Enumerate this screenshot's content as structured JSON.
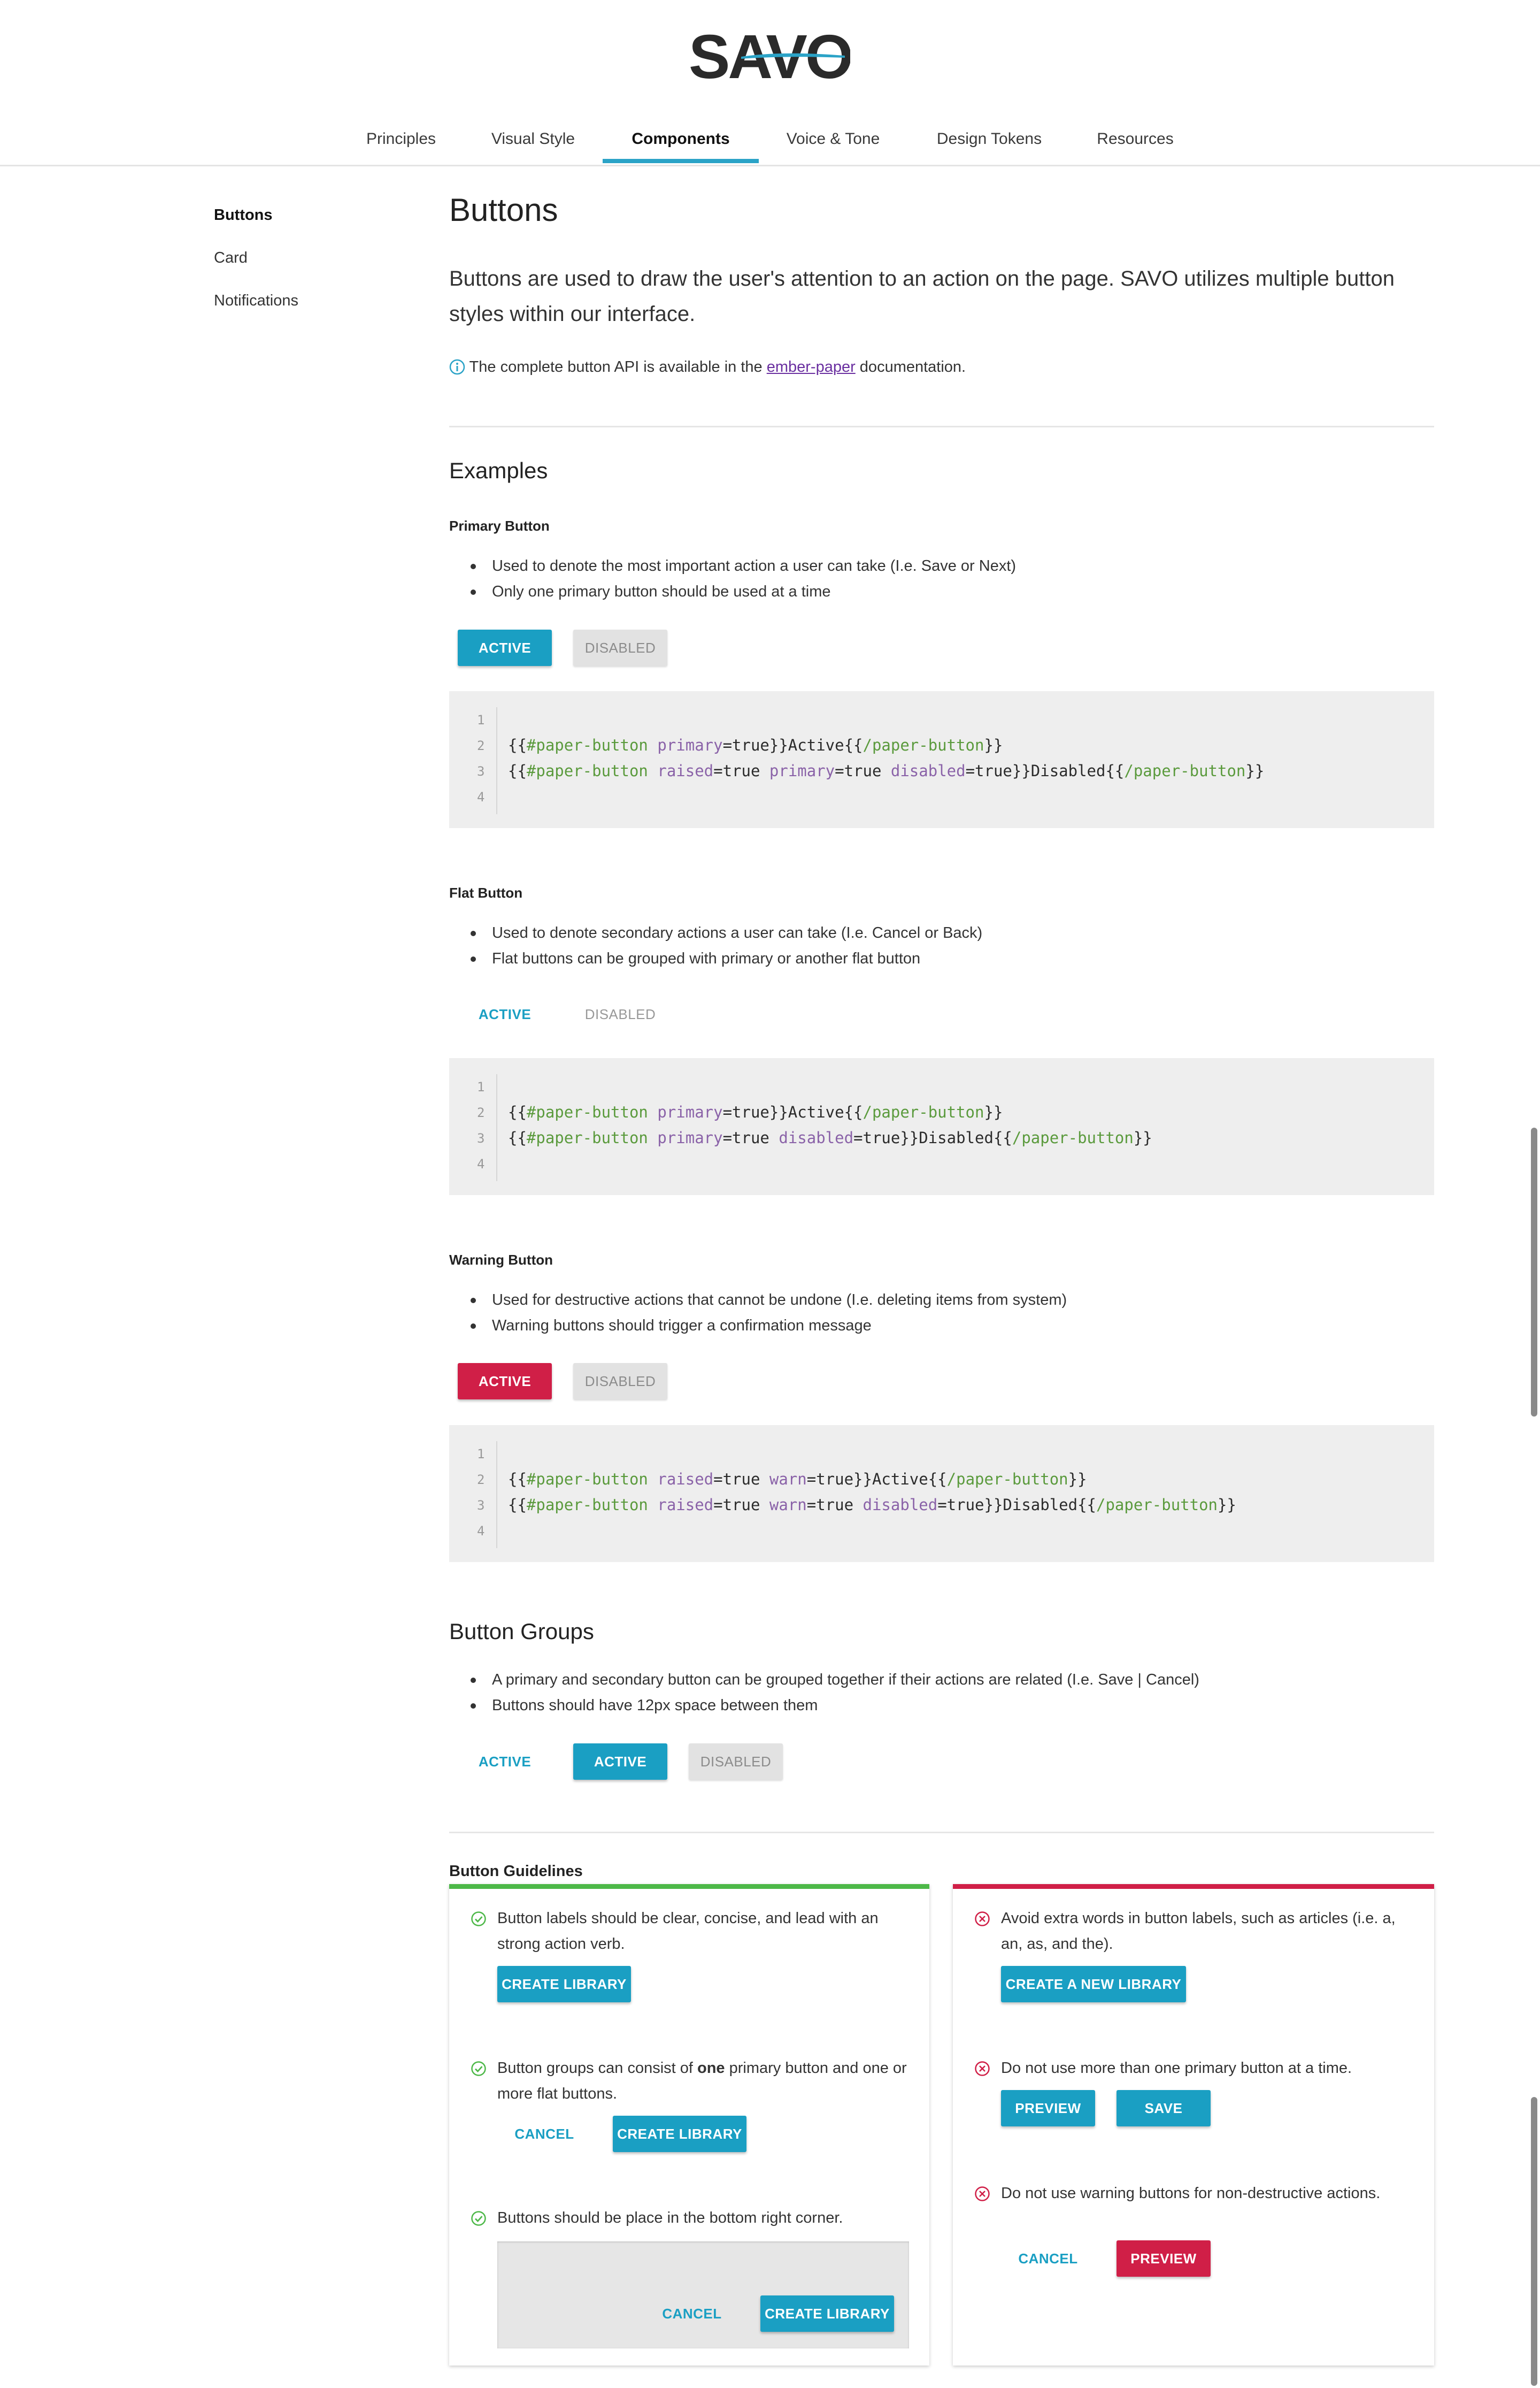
{
  "logo": {
    "text": "SAVO",
    "accent": "#2ba3c7"
  },
  "nav": {
    "items": [
      "Principles",
      "Visual Style",
      "Components",
      "Voice & Tone",
      "Design Tokens",
      "Resources"
    ],
    "active": "Components"
  },
  "sidebar": {
    "items": [
      "Buttons",
      "Card",
      "Notifications"
    ],
    "active": "Buttons"
  },
  "page": {
    "title": "Buttons",
    "lead": "Buttons are used to draw the user's attention to an action on the page. SAVO utilizes multiple button styles within our interface.",
    "info_prefix": "The complete button API is available in the ",
    "info_link": "ember-paper",
    "info_suffix": " documentation."
  },
  "examples": {
    "heading": "Examples",
    "primary": {
      "title": "Primary Button",
      "bullets": [
        "Used to denote the most important action a user can take (I.e. Save or Next)",
        "Only one primary button should be used at a time"
      ],
      "active_label": "ACTIVE",
      "disabled_label": "DISABLED",
      "code_line_numbers": [
        "1",
        "2",
        "3",
        "4"
      ]
    },
    "flat": {
      "title": "Flat Button",
      "bullets": [
        "Used to denote secondary actions a user can take (I.e. Cancel or Back)",
        "Flat buttons can be grouped with primary or another flat button"
      ],
      "active_label": "ACTIVE",
      "disabled_label": "DISABLED",
      "code_line_numbers": [
        "1",
        "2",
        "3",
        "4"
      ]
    },
    "warning": {
      "title": "Warning Button",
      "bullets": [
        "Used for destructive actions that cannot be undone (I.e. deleting items from system)",
        "Warning buttons should trigger a confirmation message"
      ],
      "active_label": "ACTIVE",
      "disabled_label": "DISABLED",
      "code_line_numbers": [
        "1",
        "2",
        "3",
        "4"
      ]
    }
  },
  "code": {
    "primary": [
      [
        [
          "p",
          "{{"
        ],
        [
          "t",
          "#paper-button"
        ],
        [
          "p",
          " "
        ],
        [
          "a",
          "primary"
        ],
        [
          "p",
          "=true}}Active{{"
        ],
        [
          "t",
          "/paper-button"
        ],
        [
          "p",
          "}}"
        ]
      ],
      [
        [
          "p",
          "{{"
        ],
        [
          "t",
          "#paper-button"
        ],
        [
          "p",
          " "
        ],
        [
          "a",
          "raised"
        ],
        [
          "p",
          "=true "
        ],
        [
          "a",
          "primary"
        ],
        [
          "p",
          "=true "
        ],
        [
          "a",
          "disabled"
        ],
        [
          "p",
          "=true}}Disabled{{"
        ],
        [
          "t",
          "/paper-button"
        ],
        [
          "p",
          "}}"
        ]
      ]
    ],
    "flat": [
      [
        [
          "p",
          "{{"
        ],
        [
          "t",
          "#paper-button"
        ],
        [
          "p",
          " "
        ],
        [
          "a",
          "primary"
        ],
        [
          "p",
          "=true}}Active{{"
        ],
        [
          "t",
          "/paper-button"
        ],
        [
          "p",
          "}}"
        ]
      ],
      [
        [
          "p",
          "{{"
        ],
        [
          "t",
          "#paper-button"
        ],
        [
          "p",
          " "
        ],
        [
          "a",
          "primary"
        ],
        [
          "p",
          "=true "
        ],
        [
          "a",
          "disabled"
        ],
        [
          "p",
          "=true}}Disabled{{"
        ],
        [
          "t",
          "/paper-button"
        ],
        [
          "p",
          "}}"
        ]
      ]
    ],
    "warning": [
      [
        [
          "p",
          "{{"
        ],
        [
          "t",
          "#paper-button"
        ],
        [
          "p",
          " "
        ],
        [
          "a",
          "raised"
        ],
        [
          "p",
          "=true "
        ],
        [
          "a",
          "warn"
        ],
        [
          "p",
          "=true}}Active{{"
        ],
        [
          "t",
          "/paper-button"
        ],
        [
          "p",
          "}}"
        ]
      ],
      [
        [
          "p",
          "{{"
        ],
        [
          "t",
          "#paper-button"
        ],
        [
          "p",
          " "
        ],
        [
          "a",
          "raised"
        ],
        [
          "p",
          "=true "
        ],
        [
          "a",
          "warn"
        ],
        [
          "p",
          "=true "
        ],
        [
          "a",
          "disabled"
        ],
        [
          "p",
          "=true}}Disabled{{"
        ],
        [
          "t",
          "/paper-button"
        ],
        [
          "p",
          "}}"
        ]
      ]
    ]
  },
  "groups": {
    "heading": "Button Groups",
    "bullets": [
      "A primary and secondary button can be grouped together if their actions are related (I.e. Save | Cancel)",
      "Buttons should have 12px space between them"
    ],
    "flat_label": "ACTIVE",
    "primary_label": "ACTIVE",
    "disabled_label": "DISABLED"
  },
  "guidelines": {
    "heading": "Button Guidelines",
    "do_color": "#4db848",
    "dont_color": "#d01f47",
    "do": [
      {
        "text": "Button labels should be clear, concise, and lead with an strong action verb.",
        "buttons": [
          "CREATE LIBRARY"
        ]
      },
      {
        "text_prefix": "Button groups can consist of ",
        "text_bold": "one",
        "text_suffix": " primary button and one or more flat buttons.",
        "flat": "CANCEL",
        "primary": "CREATE LIBRARY"
      },
      {
        "text": "Buttons should be place in the bottom right corner.",
        "flat": "CANCEL",
        "primary": "CREATE LIBRARY"
      }
    ],
    "dont": [
      {
        "text": "Avoid extra words in button labels, such as articles (i.e. a, an, as, and the).",
        "primary": "CREATE A NEW LIBRARY"
      },
      {
        "text": "Do not use more than one primary button at a time.",
        "primary_a": "PREVIEW",
        "primary_b": "SAVE"
      },
      {
        "text": "Do not use warning buttons for non-destructive actions.",
        "flat": "CANCEL",
        "warn": "PREVIEW"
      }
    ]
  }
}
